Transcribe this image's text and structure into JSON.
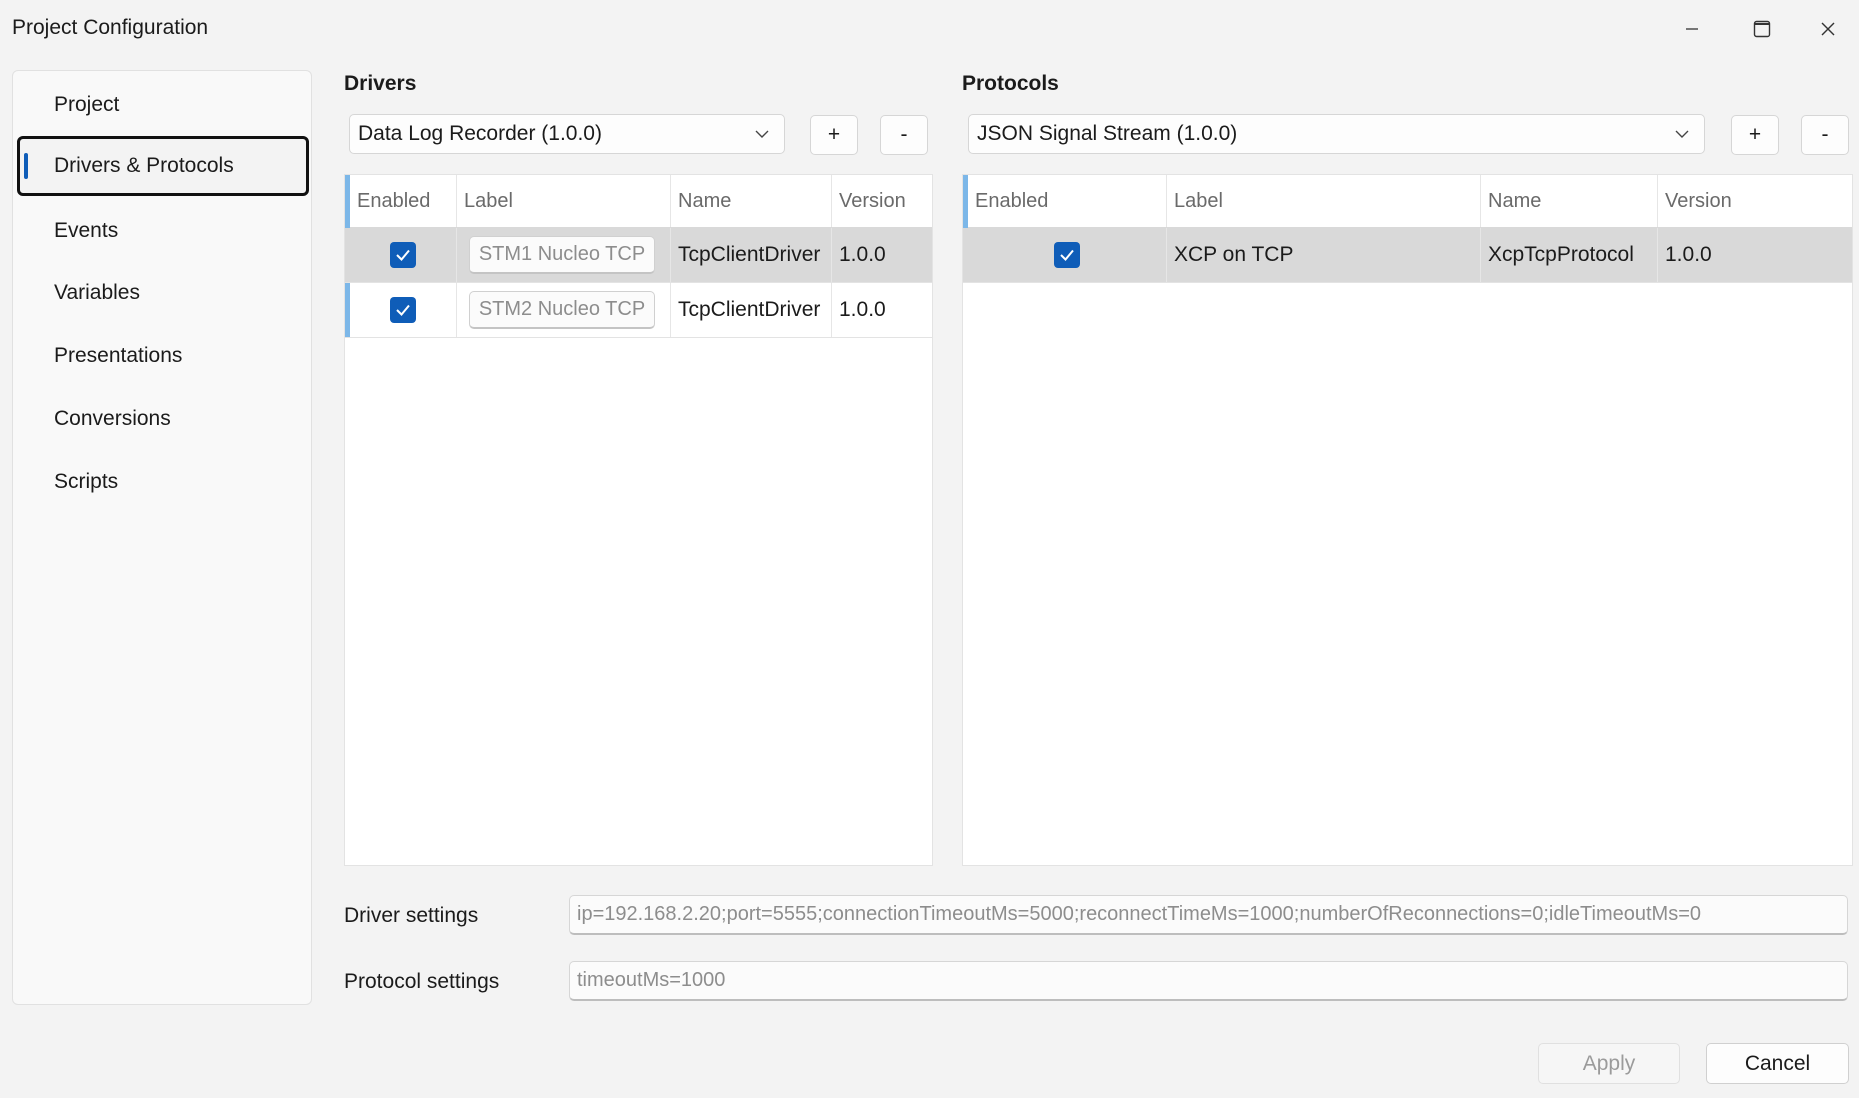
{
  "window": {
    "title": "Project Configuration",
    "controls": [
      "minimize-icon",
      "maximize-icon",
      "close-icon"
    ]
  },
  "sidebar": {
    "items": [
      {
        "label": "Project",
        "selected": false
      },
      {
        "label": "Drivers & Protocols",
        "selected": true
      },
      {
        "label": "Events",
        "selected": false
      },
      {
        "label": "Variables",
        "selected": false
      },
      {
        "label": "Presentations",
        "selected": false
      },
      {
        "label": "Conversions",
        "selected": false
      },
      {
        "label": "Scripts",
        "selected": false
      }
    ]
  },
  "drivers": {
    "title": "Drivers",
    "selected_type": "Data Log Recorder (1.0.0)",
    "add_label": "+",
    "remove_label": "-",
    "columns": [
      "Enabled",
      "Label",
      "Name",
      "Version"
    ],
    "rows": [
      {
        "enabled": true,
        "label": "STM1 Nucleo TCP",
        "name": "TcpClientDriver",
        "version": "1.0.0",
        "selected": true
      },
      {
        "enabled": true,
        "label": "STM2 Nucleo TCP",
        "name": "TcpClientDriver",
        "version": "1.0.0",
        "selected": false
      }
    ]
  },
  "protocols": {
    "title": "Protocols",
    "selected_type": "JSON Signal Stream (1.0.0)",
    "add_label": "+",
    "remove_label": "-",
    "columns": [
      "Enabled",
      "Label",
      "Name",
      "Version"
    ],
    "rows": [
      {
        "enabled": true,
        "label": "XCP on TCP",
        "name": "XcpTcpProtocol",
        "version": "1.0.0",
        "selected": true
      }
    ]
  },
  "settings": {
    "driver_label": "Driver settings",
    "driver_value": "ip=192.168.2.20;port=5555;connectionTimeoutMs=5000;reconnectTimeMs=1000;numberOfReconnections=0;idleTimeoutMs=0",
    "protocol_label": "Protocol settings",
    "protocol_value": "timeoutMs=1000"
  },
  "footer": {
    "apply_label": "Apply",
    "apply_enabled": false,
    "cancel_label": "Cancel"
  },
  "colors": {
    "accent": "#0f5db8",
    "row_accent": "#7cb7e8",
    "selected_row": "#d9d9d9",
    "background": "#f3f3f3"
  }
}
